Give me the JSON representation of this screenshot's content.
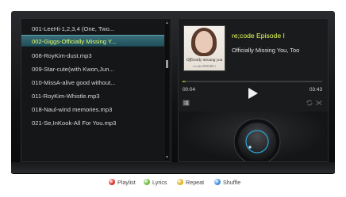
{
  "playlist": {
    "items": [
      {
        "label": "001-LeeHi-1,2,3,4 (One, Two..."
      },
      {
        "label": "002-Giggs-Officially Missing Y..."
      },
      {
        "label": "008-RoyKim-dust.mp3"
      },
      {
        "label": "009-Star-cute(with Kwon,Jun..."
      },
      {
        "label": "010-MissA-alive good without..."
      },
      {
        "label": "011-RoyKim-Whistle.mp3"
      },
      {
        "label": "018-Naul-wind memories.mp3"
      },
      {
        "label": "021-Se,InKook-All For You.mp3"
      }
    ],
    "selected_index": 1
  },
  "now_playing": {
    "album_title": "re;code Episode I",
    "track_title": "Officially Missing You, Too",
    "cover_text": "Officially missing you",
    "cover_subtext": "re;code EPISODE I",
    "current_time": "00:04",
    "total_time": "03:43",
    "progress": 0.02
  },
  "legend": {
    "items": [
      {
        "label": "Playlist",
        "color": "#d9332b"
      },
      {
        "label": "Lyrics",
        "color": "#6cbf3a"
      },
      {
        "label": "Repeat",
        "color": "#e0b21c"
      },
      {
        "label": "Shuffle",
        "color": "#3f8fe0"
      }
    ]
  },
  "colors": {
    "accent": "#e8ff5a",
    "selection": "#2d6470",
    "panel": "#1a1b1d"
  },
  "icons": [
    "play-icon",
    "list-icon",
    "repeat-icon",
    "shuffle-icon",
    "power-icon",
    "volume-knob"
  ]
}
